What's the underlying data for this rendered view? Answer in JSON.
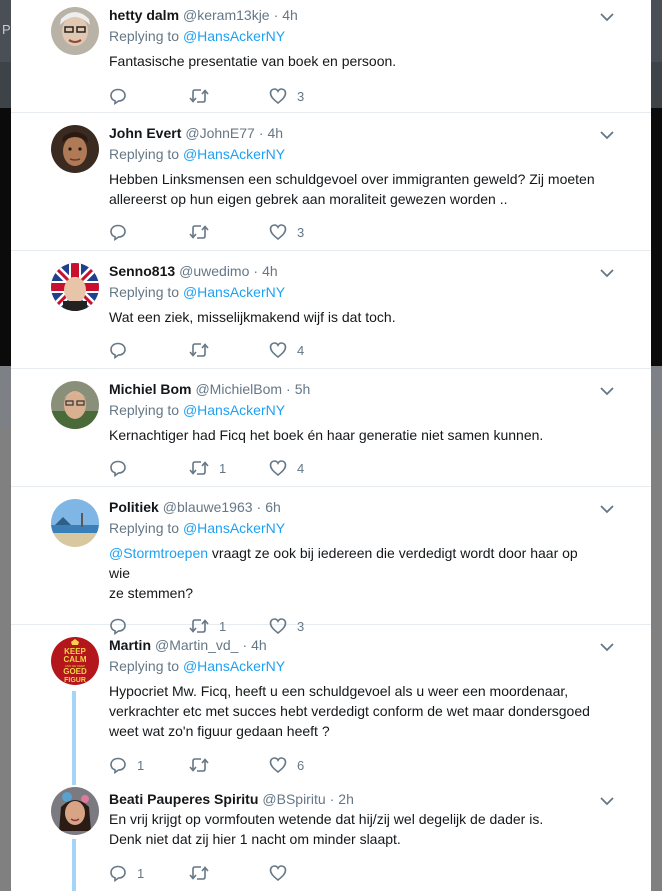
{
  "background": {
    "letter": "P"
  },
  "tweets": [
    {
      "name": "hetty dalm",
      "handle": "@keram13kje",
      "time": "4h",
      "reply_prefix": "Replying to",
      "reply_to": "@HansAckerNY",
      "text": "Fantasische presentatie van boek en persoon.",
      "replies": "",
      "retweets": "",
      "likes": "3"
    },
    {
      "name": "John Evert",
      "handle": "@JohnE77",
      "time": "4h",
      "reply_prefix": "Replying to",
      "reply_to": "@HansAckerNY",
      "text_lines": [
        "Hebben Linksmensen een schuldgevoel over immigranten geweld? Zij moeten",
        "allereerst op hun eigen gebrek aan moraliteit gewezen worden .."
      ],
      "replies": "",
      "retweets": "",
      "likes": "3"
    },
    {
      "name": "Senno813",
      "handle": "@uwedimo",
      "time": "4h",
      "reply_prefix": "Replying to",
      "reply_to": "@HansAckerNY",
      "text": "Wat een ziek, misselijkmakend wijf is dat toch.",
      "replies": "",
      "retweets": "",
      "likes": "4"
    },
    {
      "name": "Michiel Bom",
      "handle": "@MichielBom",
      "time": "5h",
      "reply_prefix": "Replying to",
      "reply_to": "@HansAckerNY",
      "text": "Kernachtiger had Ficq het boek én haar generatie niet samen kunnen.",
      "replies": "",
      "retweets": "1",
      "likes": "4"
    },
    {
      "name": "Politiek",
      "handle": "@blauwe1963",
      "time": "6h",
      "reply_prefix": "Replying to",
      "reply_to": "@HansAckerNY",
      "mention": "@Stormtroepen",
      "text_after_mention": " vraagt ze ook bij iedereen die verdedigt wordt door haar op wie",
      "text_line2": "ze stemmen?",
      "replies": "",
      "retweets": "1",
      "likes": "3"
    },
    {
      "name": "Martin",
      "handle": "@Martin_vd_",
      "time": "4h",
      "reply_prefix": "Replying to",
      "reply_to": "@HansAckerNY",
      "text_lines": [
        "Hypocriet Mw. Ficq, heeft u een schuldgevoel als u weer een moordenaar,",
        "verkrachter etc met succes hebt verdedigt conform de wet maar dondersgoed",
        "weet wat zo'n figuur gedaan heeft ?"
      ],
      "avatar_text": [
        "KEEP",
        "CALM",
        "AND NE KEEP",
        "GOED",
        "FIGUR"
      ],
      "replies": "1",
      "retweets": "",
      "likes": "6"
    },
    {
      "name": "Beati Pauperes Spiritu",
      "handle": "@BSpiritu",
      "time": "2h",
      "text_lines": [
        "En vrij krijgt op vormfouten wetende dat hij/zij wel degelijk de dader is.",
        "Denk niet dat zij hier 1 nacht om minder slaapt."
      ],
      "replies": "1",
      "retweets": "",
      "likes": ""
    }
  ],
  "colors": {
    "link": "#1da1f2",
    "muted": "#657786",
    "thread": "#a5d4f7"
  }
}
